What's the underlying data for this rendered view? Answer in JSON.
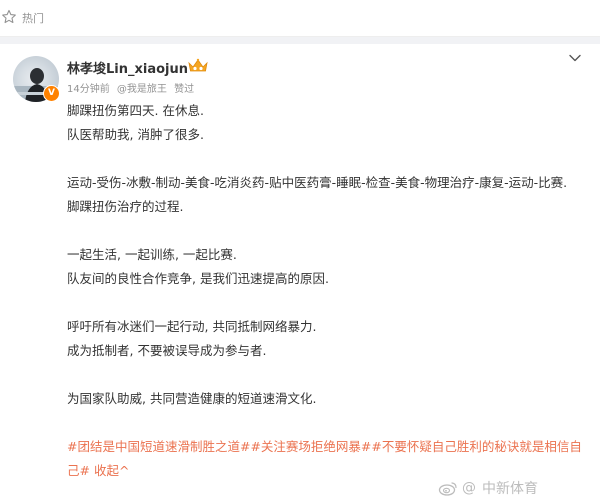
{
  "topbar": {
    "hot_label": "热门"
  },
  "post": {
    "author": {
      "name": "林孝埈Lin_xiaojun",
      "verified_mark": "V"
    },
    "meta": {
      "time": "14分钟前",
      "source": "@我是旅王",
      "liked": "赞过"
    },
    "lines": [
      "脚踝扭伤第四天. 在休息.",
      "队医帮助我, 消肿了很多.",
      "",
      "运动-受伤-冰敷-制动-美食-吃消炎药-贴中医药膏-睡眠-检查-美食-物理治疗-康复-运动-比赛.",
      "脚踝扭伤治疗的过程.",
      "",
      "一起生活, 一起训练, 一起比赛.",
      "队友间的良性合作竞争, 是我们迅速提高的原因.",
      "",
      "呼吁所有冰迷们一起行动, 共同抵制网络暴力.",
      "成为抵制者, 不要被误导成为参与者.",
      "",
      "为国家队助威, 共同营造健康的短道速滑文化."
    ],
    "tags": [
      "#团结是中国短道速滑制胜之道#",
      "#关注赛场拒绝网暴#",
      "#不要怀疑自己胜利的秘诀就是相信自己#"
    ],
    "collapse_label": "收起^"
  },
  "watermark": {
    "sep": "@",
    "text": "中新体育"
  },
  "colors": {
    "accent": "#eb7350",
    "meta": "#939393",
    "verify": "#ff8200",
    "crown": "#f5a623"
  },
  "icons": {
    "hot": "hot-star-icon",
    "crown": "vip-crown-icon",
    "more": "chevron-down-icon",
    "watermark": "weibo-logo-icon"
  }
}
